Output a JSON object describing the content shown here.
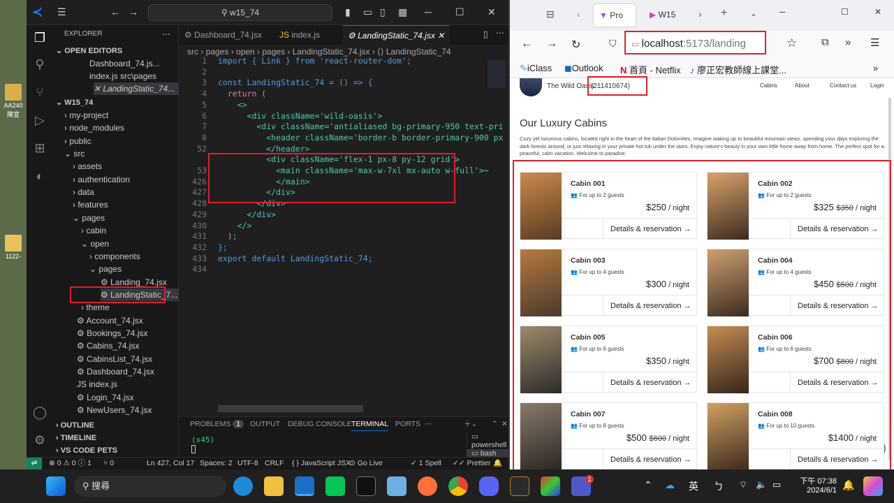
{
  "desktop": {
    "icons": [
      {
        "label": "AA240\n陳宣"
      },
      {
        "label": "1122-"
      }
    ]
  },
  "vscode": {
    "search": "w15_74",
    "tabs": [
      "Dashboard_74.jsx",
      "index.js",
      "LandingStatic_74.jsx"
    ],
    "breadcrumb": "src › pages › open › pages › LandingStatic_74.jsx › ⟨⟩ LandingStatic_74",
    "explorer_title": "EXPLORER",
    "open_editors_label": "OPEN EDITORS",
    "open_editors": [
      {
        "label": "Dashboard_74.js..."
      },
      {
        "label": "index.js  src\\pages"
      },
      {
        "label": "✕  LandingStatic_74..."
      }
    ],
    "project_label": "W15_74",
    "tree": [
      {
        "label": "› my-project"
      },
      {
        "label": "› node_modules"
      },
      {
        "label": "› public"
      },
      {
        "label": "⌄ src"
      },
      {
        "label": "› assets"
      },
      {
        "label": "› authentication"
      },
      {
        "label": "› data"
      },
      {
        "label": "› features"
      },
      {
        "label": "⌄ pages"
      },
      {
        "label": "› cabin"
      },
      {
        "label": "⌄ open"
      },
      {
        "label": "› components"
      },
      {
        "label": "⌄ pages"
      },
      {
        "label": "⚙ Landing_74.jsx"
      },
      {
        "label": "⚙ LandingStatic_7..."
      },
      {
        "label": "› theme"
      },
      {
        "label": "⚙ Account_74.jsx"
      },
      {
        "label": "⚙ Bookings_74.jsx"
      },
      {
        "label": "⚙ Cabins_74.jsx"
      },
      {
        "label": "⚙ CabinsList_74.jsx"
      },
      {
        "label": "⚙ Dashboard_74.jsx"
      },
      {
        "label": "JS index.js"
      },
      {
        "label": "⚙ Login_74.jsx"
      },
      {
        "label": "⚙ NewUsers_74.jsx"
      }
    ],
    "bottom_sections": [
      "› OUTLINE",
      "› TIMELINE",
      "› VS CODE PETS"
    ],
    "code_lines": [
      {
        "n": "1",
        "text": "import { Link } from 'react-router-dom';"
      },
      {
        "n": "2",
        "text": ""
      },
      {
        "n": "3",
        "text": "const LandingStatic_74 = () => {"
      },
      {
        "n": "4",
        "text": "  return ("
      },
      {
        "n": "5",
        "text": "    <>"
      },
      {
        "n": "6",
        "text": "      <div className='wild-oasis'>"
      },
      {
        "n": "7",
        "text": "        <div className='antialiased bg-primary-950 text-pri"
      },
      {
        "n": "8",
        "text": "          <header className='border-b border-primary-900 px"
      },
      {
        "n": "52",
        "text": "          </header>"
      },
      {
        "n": "",
        "text": "          <div className='flex-1 px-8 py-12 grid'>"
      },
      {
        "n": "53",
        "text": "            <main className='max-w-7xl mx-auto w-full'>⋯"
      },
      {
        "n": "426",
        "text": "            </main>"
      },
      {
        "n": "427",
        "text": "          </div>"
      },
      {
        "n": "428",
        "text": "        </div>"
      },
      {
        "n": "429",
        "text": "      </div>"
      },
      {
        "n": "430",
        "text": "    </>"
      },
      {
        "n": "431",
        "text": "  );"
      },
      {
        "n": "432",
        "text": "};"
      },
      {
        "n": "433",
        "text": "export default LandingStatic_74;"
      },
      {
        "n": "434",
        "text": ""
      }
    ],
    "panel_tabs": [
      "PROBLEMS",
      "OUTPUT",
      "DEBUG CONSOLE",
      "TERMINAL",
      "PORTS"
    ],
    "problems_count": "1",
    "terminal_text": "(x45)",
    "terminals": [
      "powershell",
      "bash"
    ],
    "status": {
      "errors": "⊗ 0 ⚠ 0 ⓘ 1",
      "ports": "⑂ 0",
      "position": "Ln 427, Col 17",
      "spaces": "Spaces: 2",
      "encoding": "UTF-8",
      "eol": "CRLF",
      "language": "{ } JavaScript JSX",
      "golive": "⊙ Go Live",
      "spell": "✓ 1 Spell",
      "prettier": "✓✓ Prettier"
    }
  },
  "browser": {
    "tab_title": "Pro",
    "tab2_title": "W15",
    "url_host": "localhost",
    "url_path": ":5173/landing",
    "bookmarks": [
      "iClass",
      "Outlook",
      "首頁 - Netflix",
      "廖正宏教師線上課堂..."
    ],
    "page": {
      "brand": "The Wild Oasis",
      "student_id": "(211410674)",
      "nav": [
        "Cabins",
        "About",
        "Contact us",
        "Login"
      ],
      "heading": "Our Luxury Cabins",
      "intro": "Cozy yet luxurious cabins, located right in the heart of the Italian Dolomites. Imagine waking up to beautiful mountain views, spending your days exploring the dark forests around, or just relaxing in your private hot tub under the stars. Enjoy nature's beauty in your own little home away from home. The perfect spot for a peaceful, calm vacation. Welcome to paradise.",
      "cabins": [
        {
          "name": "Cabin 001",
          "guests": "For up to 2 guests",
          "price": "$250",
          "old": "",
          "unit": " / night",
          "link": "Details & reservation →"
        },
        {
          "name": "Cabin 002",
          "guests": "For up to 2 guests",
          "price": "$325",
          "old": "$350",
          "unit": " / night",
          "link": "Details & reservation →"
        },
        {
          "name": "Cabin 003",
          "guests": "For up to 4 guests",
          "price": "$300",
          "old": "",
          "unit": " / night",
          "link": "Details & reservation →"
        },
        {
          "name": "Cabin 004",
          "guests": "For up to 4 guests",
          "price": "$450",
          "old": "$500",
          "unit": " / night",
          "link": "Details & reservation →"
        },
        {
          "name": "Cabin 005",
          "guests": "For up to 6 guests",
          "price": "$350",
          "old": "",
          "unit": " / night",
          "link": "Details & reservation →"
        },
        {
          "name": "Cabin 006",
          "guests": "For up to 6 guests",
          "price": "$700",
          "old": "$800",
          "unit": " / night",
          "link": "Details & reservation →"
        },
        {
          "name": "Cabin 007",
          "guests": "For up to 8 guests",
          "price": "$500",
          "old": "$600",
          "unit": " / night",
          "link": "Details & reservation →"
        },
        {
          "name": "Cabin 008",
          "guests": "For up to 10 guests",
          "price": "$1400",
          "old": "",
          "unit": " / night",
          "link": "Details & reservation →"
        }
      ]
    }
  },
  "taskbar": {
    "search_label": "搜尋",
    "ime": "英",
    "ime2": "ㄅ",
    "time": "下午 07:38",
    "date": "2024/6/1",
    "teams_badge": "1"
  },
  "colors": {
    "accent": "#0078d4",
    "highlight": "#e0202a"
  }
}
